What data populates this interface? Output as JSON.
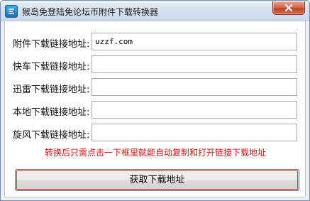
{
  "window": {
    "title": "猴岛免登陆免论坛币附件下载转换器"
  },
  "icons": {
    "app": "app-logo-icon",
    "close": "close-icon"
  },
  "form": {
    "rows": [
      {
        "label": "附件下载链接地址:",
        "value": "uzzf.com"
      },
      {
        "label": "快车下载链接地址:",
        "value": ""
      },
      {
        "label": "迅雷下载链接地址:",
        "value": ""
      },
      {
        "label": "本地下载链接地址:",
        "value": ""
      },
      {
        "label": "旋风下载链接地址:",
        "value": ""
      }
    ],
    "hint": "转换后只需点击一下框里就能自动复制和打开链接下载地址",
    "submit_label": "获取下载地址"
  },
  "colors": {
    "hint": "#e01010",
    "titlebar": "#d6e2f0",
    "close": "#c1432b"
  }
}
